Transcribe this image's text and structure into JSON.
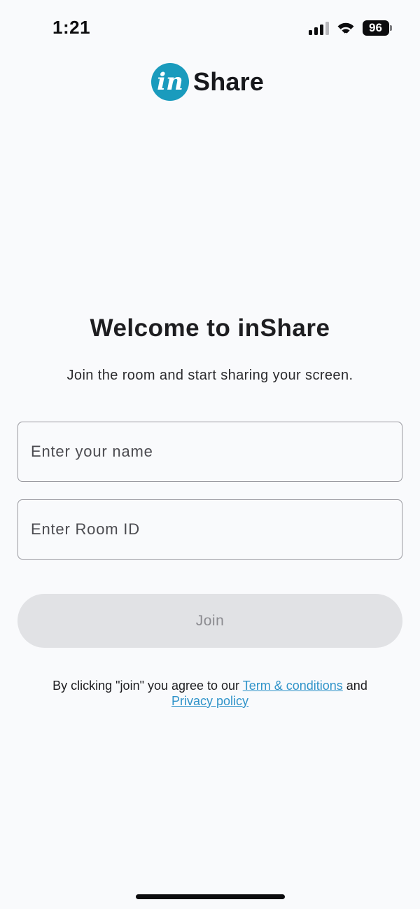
{
  "status_bar": {
    "time": "1:21",
    "battery": "96",
    "icons": [
      "cellular-signal-icon",
      "wifi-icon",
      "battery-icon"
    ]
  },
  "logo": {
    "mark": "in",
    "word": "Share",
    "mark_color": "#1a9bbd"
  },
  "welcome": {
    "title": "Welcome to inShare",
    "subtitle": "Join the room and start sharing your screen."
  },
  "form": {
    "name_placeholder": "Enter your name",
    "room_placeholder": "Enter Room ID",
    "name_value": "",
    "room_value": "",
    "join_label": "Join"
  },
  "terms": {
    "prefix": "By clicking \"join\" you agree to our ",
    "terms_link": "Term & conditions",
    "middle": " and",
    "privacy_link": "Privacy policy",
    "link_color": "#2f93c9"
  },
  "colors": {
    "background": "#f9fafc",
    "button_disabled_bg": "#e1e2e5",
    "button_disabled_text": "#8b8b90"
  }
}
